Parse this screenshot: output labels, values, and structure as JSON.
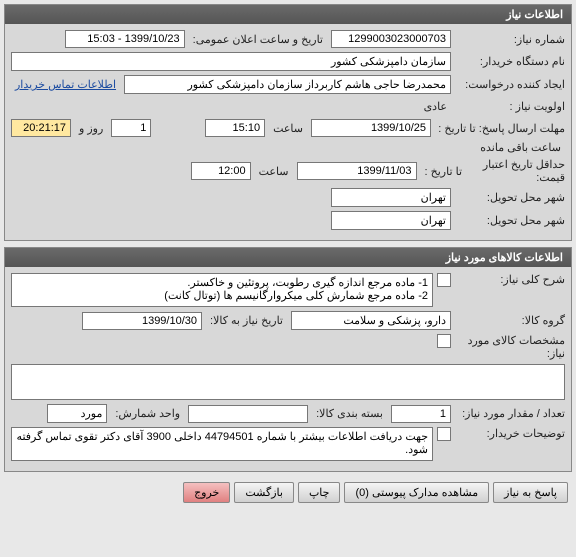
{
  "panel1": {
    "title": "اطلاعات نیاز",
    "labels": {
      "need_no": "شماره نیاز:",
      "announce_datetime": "تاریخ و ساعت اعلان عمومی:",
      "buyer_org": "نام دستگاه خریدار:",
      "creator": "ایجاد کننده درخواست:",
      "contact": "اطلاعات تماس خریدار",
      "priority": "اولویت نیاز :",
      "deadline": "مهلت ارسال پاسخ:  تا تاریخ :",
      "time": "ساعت",
      "days": "روز و",
      "remaining": "ساعت باقی مانده",
      "validity": "حداقل تاریخ اعتبار قیمت:",
      "to_date": "تا تاریخ :",
      "delivery_city": "شهر محل تحویل:",
      "delivery_city2": "شهر محل تحویل:"
    },
    "values": {
      "need_no": "1299003023000703",
      "announce_datetime": "1399/10/23 - 15:03",
      "buyer_org": "سازمان دامپزشکی کشور",
      "creator": "محمدرضا حاجی هاشم کاربرداز سازمان دامپزشکی کشور",
      "priority": "عادی",
      "deadline_date": "1399/10/25",
      "deadline_time": "15:10",
      "days_left": "1",
      "time_left": "20:21:17",
      "validity_date": "1399/11/03",
      "validity_time": "12:00",
      "city1": "تهران",
      "city2": "تهران"
    }
  },
  "panel2": {
    "title": "اطلاعات کالاهای مورد نیاز",
    "labels": {
      "general_desc": "شرح کلی نیاز:",
      "goods_group": "گروه کالا:",
      "need_date": "تاریخ نیاز به کالا:",
      "goods_spec": "مشخصات کالای مورد نیاز:",
      "qty": "تعداد / مقدار مورد نیاز:",
      "package": "بسته بندی کالا:",
      "count_unit": "واحد شمارش:",
      "buyer_notes": "توضیحات خریدار:"
    },
    "values": {
      "general_desc": "1- ماده مرجع اندازه گیری رطوبت، پروتئین و خاکستر.\n2- ماده مرجع شمارش کلی میکروارگانیسم ها (توتال کانت)",
      "goods_group": "دارو، پزشکی و سلامت",
      "need_date": "1399/10/30",
      "qty": "1",
      "count_unit": "مورد",
      "buyer_notes": "جهت دریافت اطلاعات بیشتر با شماره 44794501 داخلی 3900 آقای دکتر تقوی تماس گرفته شود."
    }
  },
  "buttons": {
    "respond": "پاسخ به نیاز",
    "attachments": "مشاهده مدارک پیوستی (0)",
    "print": "چاپ",
    "back": "بازگشت",
    "exit": "خروج"
  }
}
